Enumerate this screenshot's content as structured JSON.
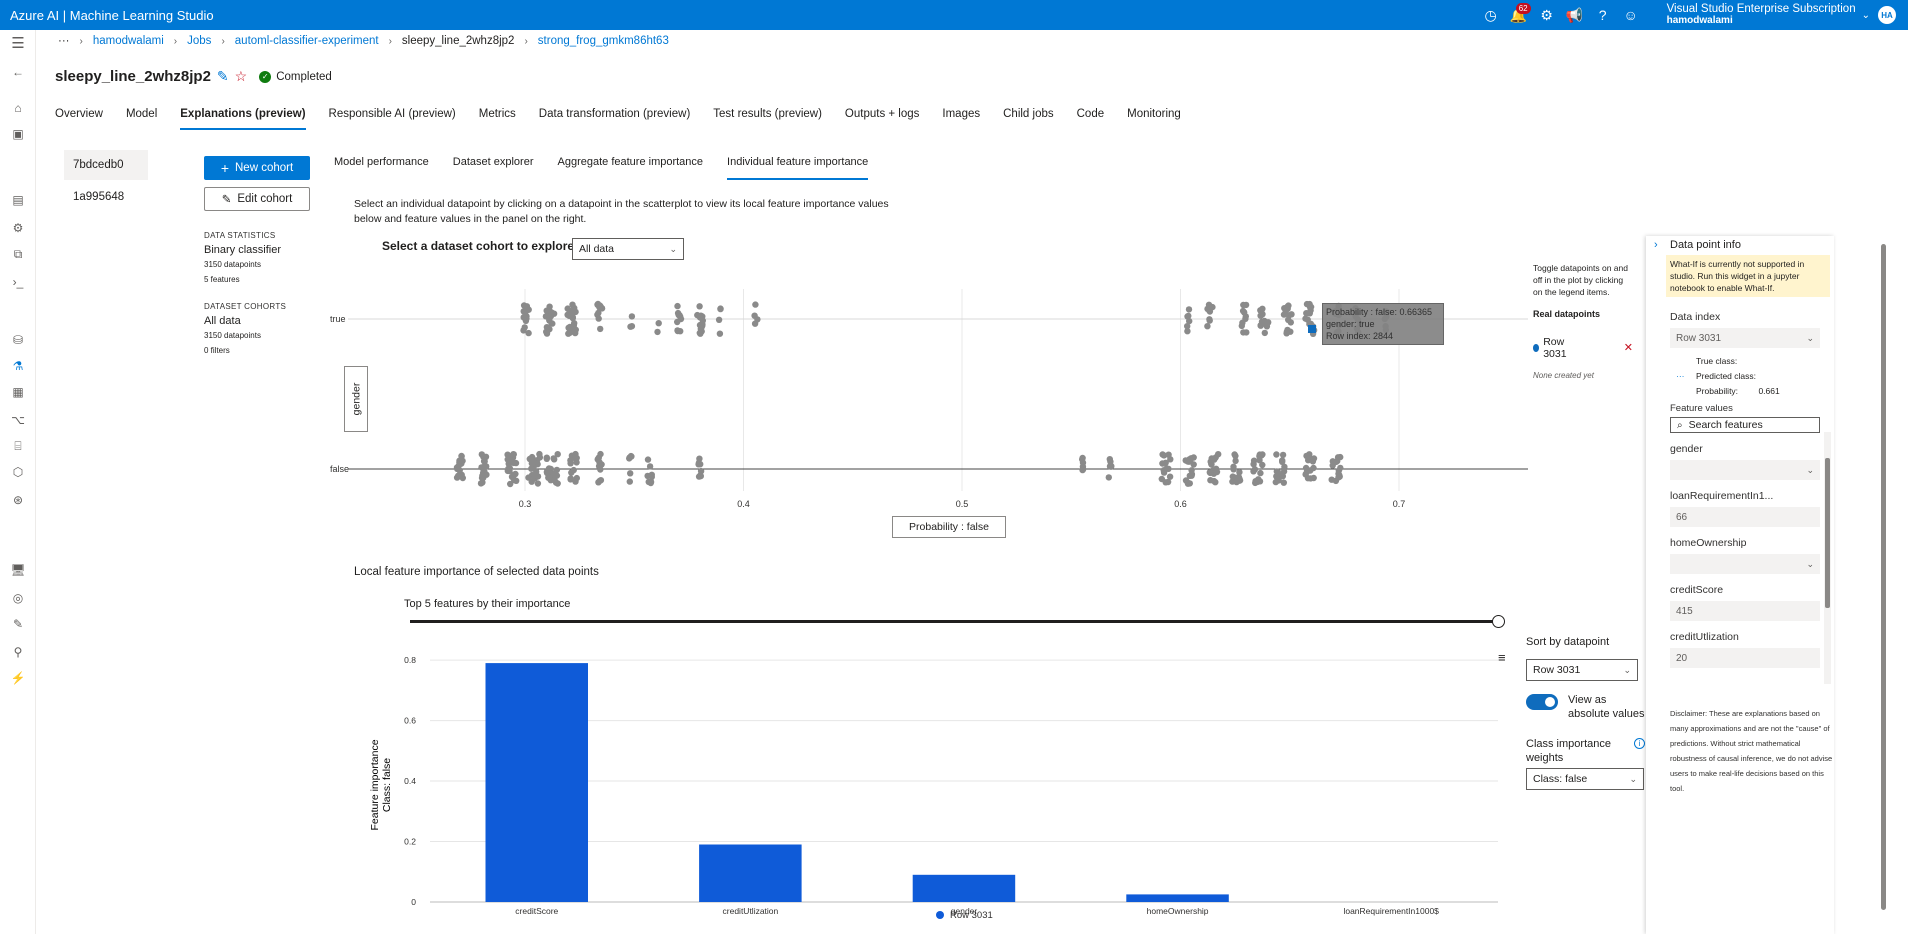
{
  "app": {
    "title": "Azure AI | Machine Learning Studio",
    "notifications_count": "62",
    "subscription": "Visual Studio Enterprise Subscription",
    "user": "hamodwalami",
    "avatar": "HA"
  },
  "breadcrumbs": [
    "···",
    "hamodwalami",
    "Jobs",
    "automl-classifier-experiment",
    "sleepy_line_2whz8jp2",
    "strong_frog_gmkm86ht63"
  ],
  "job": {
    "name": "sleepy_line_2whz8jp2",
    "status": "Completed"
  },
  "main_tabs": [
    "Overview",
    "Model",
    "Explanations (preview)",
    "Responsible AI (preview)",
    "Metrics",
    "Data transformation (preview)",
    "Test results (preview)",
    "Outputs + logs",
    "Images",
    "Child jobs",
    "Code",
    "Monitoring"
  ],
  "explanations": [
    "7bdcedb0",
    "1a995648"
  ],
  "buttons": {
    "new_cohort": "New cohort",
    "edit_cohort": "Edit cohort"
  },
  "stats": {
    "data_statistics_header": "DATA STATISTICS",
    "classifier": "Binary classifier",
    "datapoints": "3150 datapoints",
    "features": "5 features",
    "cohorts_header": "DATASET COHORTS",
    "cohort_name": "All data",
    "cohort_datapoints": "3150 datapoints",
    "cohort_filters": "0 filters"
  },
  "sub_tabs": [
    "Model performance",
    "Dataset explorer",
    "Aggregate feature importance",
    "Individual feature importance"
  ],
  "instructions": "Select an individual datapoint by clicking on a datapoint in the scatterplot to view its local feature importance values below and feature values in the panel on the right.",
  "cohort_select": {
    "label": "Select a dataset cohort to explore",
    "value": "All data"
  },
  "scatter": {
    "y_axis_label": "gender",
    "x_axis_label": "Probability : false",
    "y_categories": [
      "true",
      "false"
    ],
    "x_ticks": [
      "0.3",
      "0.4",
      "0.5",
      "0.6",
      "0.7"
    ],
    "tooltip": [
      "Probability : false: 0.66365",
      "gender: true",
      "Row index: 2844"
    ]
  },
  "legend_panel": {
    "help": "Toggle datapoints on and off in the plot by clicking on the legend items.",
    "real_header": "Real datapoints",
    "row": "Row 3031",
    "none_created": "None created yet"
  },
  "local_importance": {
    "section_title": "Local feature importance of selected data points",
    "top_k_label": "Top 5 features by their importance",
    "legend": "Row 3031"
  },
  "chart_data": {
    "type": "bar",
    "categories": [
      "creditScore",
      "creditUtlization",
      "gender",
      "homeOwnership",
      "loanRequirementIn1000$"
    ],
    "series": [
      {
        "name": "Row 3031",
        "values": [
          0.79,
          0.19,
          0.09,
          0.025,
          0.0
        ]
      }
    ],
    "ylabel": "Feature importance Class: false",
    "yticks": [
      "0",
      "0.2",
      "0.4",
      "0.6",
      "0.8"
    ],
    "ylim": [
      0,
      0.84
    ],
    "color": "#0f5bd8"
  },
  "sort_panel": {
    "sort_label": "Sort by datapoint",
    "sort_value": "Row 3031",
    "toggle_label": "View as absolute values",
    "class_weights_label": "Class importance weights",
    "class_value": "Class: false"
  },
  "datapoint_panel": {
    "title": "Data point info",
    "warning": "What-If is currently not supported in studio. Run this widget in a jupyter notebook to enable What-If.",
    "data_index_label": "Data index",
    "data_index_value": "Row 3031",
    "true_class": "True class:",
    "predicted_class": "Predicted class:",
    "probability_label": "Probability:",
    "probability_value": "0.661",
    "feature_values_label": "Feature values",
    "search_placeholder": "Search features",
    "features": [
      {
        "name": "gender",
        "value": ""
      },
      {
        "name": "loanRequirementIn1...",
        "value": "66"
      },
      {
        "name": "homeOwnership",
        "value": ""
      },
      {
        "name": "creditScore",
        "value": "415"
      },
      {
        "name": "creditUtlization",
        "value": "20"
      }
    ],
    "disclaimer": "Disclaimer: These are explanations based on many approximations and are not the \"cause\" of predictions. Without strict mathematical robustness of causal inference, we do not advise users to make real-life decisions based on this tool."
  },
  "colors": {
    "accent": "#0078d4",
    "bar": "#0f5bd8",
    "point": "#8a8a8a"
  }
}
